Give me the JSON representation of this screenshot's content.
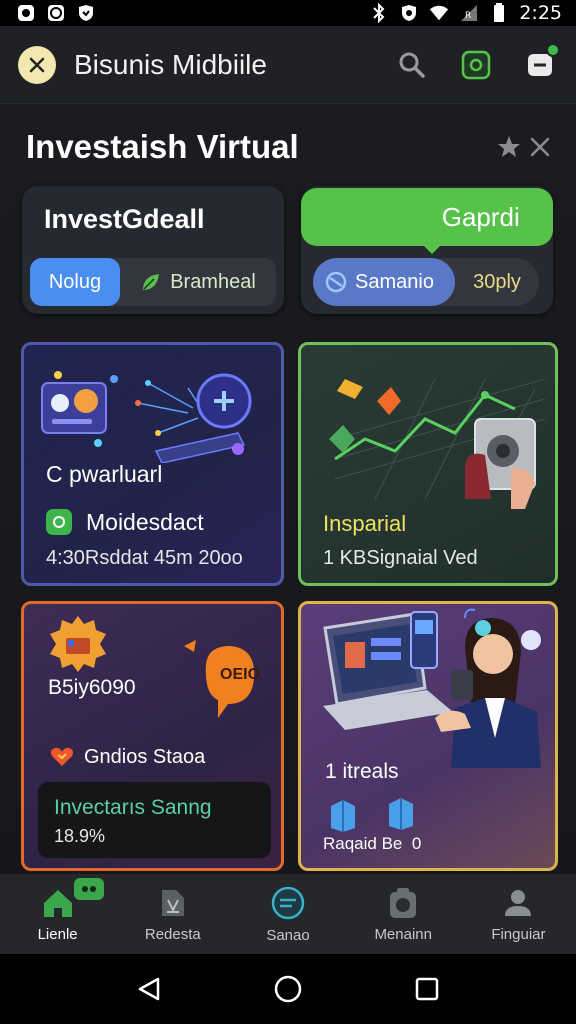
{
  "status_bar": {
    "time": "2:25",
    "left_icons": [
      "notification-icon",
      "message-icon",
      "shield-icon"
    ],
    "right_icons": [
      "bluetooth-icon",
      "alarm-icon",
      "wifi-icon",
      "signal-icon",
      "battery-icon"
    ]
  },
  "app_bar": {
    "title": "Bisunis Midbiile",
    "logo_icon": "close-icon",
    "actions": [
      "search-icon",
      "camera-icon",
      "notification-icon"
    ],
    "accent": "#3dbb49"
  },
  "main": {
    "section_title": "Investaish Virtual",
    "head_icons": [
      "star-icon",
      "close-icon"
    ],
    "top_cards": {
      "left": {
        "title": "InvestGdeall",
        "segment_a": "Nolug",
        "segment_b": "Bramheal"
      },
      "right": {
        "pill": "Gaprdi ",
        "segment_a": "Samanio",
        "segment_b": "30ply"
      }
    },
    "tiles": [
      {
        "title": "C pwarluarl",
        "subtitle": "Moidesdact",
        "meta": "4:30Rsddat 45m 20oo",
        "accent": "#4f5aa8"
      },
      {
        "title": "Insparial",
        "meta": "1 KBSignaial Ved",
        "accent": "#6fbf5a"
      },
      {
        "title": "B5iy6090",
        "badge": "OEIO",
        "subtitle": "Gndios Staoa",
        "card_title": "Invectarıs Sanng",
        "card_value": "18.9%",
        "accent": "#e06a2a"
      },
      {
        "title": "1 itreals",
        "meta": "Raqaid Be  0",
        "accent": "#d9b54a"
      }
    ]
  },
  "bottom_nav": {
    "items": [
      {
        "label": "Lienle",
        "icon": "home-icon",
        "active": true
      },
      {
        "label": "Redesta",
        "icon": "portfolio-icon",
        "active": false
      },
      {
        "label": "Sanao",
        "icon": "chat-icon",
        "active": false
      },
      {
        "label": "Menainn",
        "icon": "camera-icon",
        "active": false
      },
      {
        "label": "Finguiar",
        "icon": "profile-icon",
        "active": false
      }
    ]
  },
  "system_nav": [
    "back-icon",
    "home-icon",
    "recents-icon"
  ]
}
